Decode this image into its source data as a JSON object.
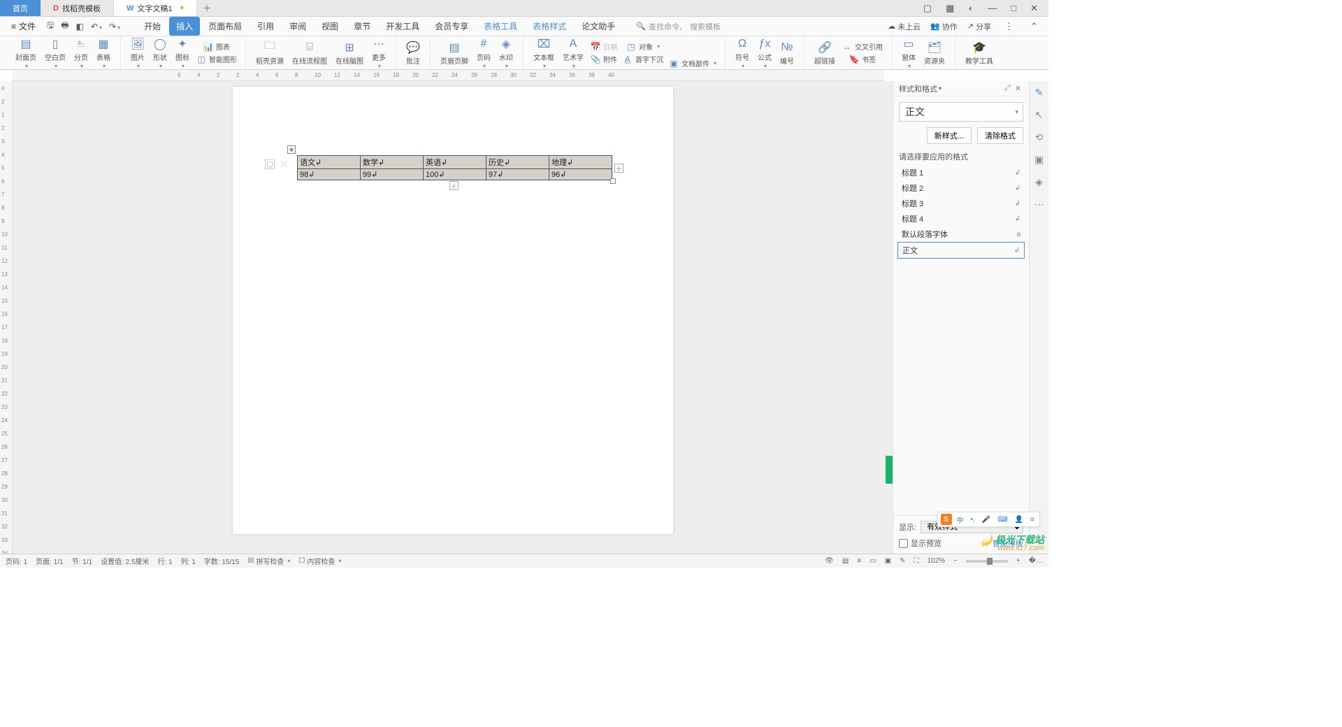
{
  "tabs": {
    "home": "首页",
    "template": "找稻壳模板",
    "doc": "文字文稿1"
  },
  "file_menu": "文件",
  "menu": {
    "start": "开始",
    "insert": "插入",
    "page_layout": "页面布局",
    "references": "引用",
    "review": "审阅",
    "view": "视图",
    "section": "章节",
    "dev": "开发工具",
    "member": "会员专享",
    "table_tools": "表格工具",
    "table_style": "表格样式",
    "paper": "论文助手"
  },
  "search": {
    "find": "查找命令、",
    "template": "搜索模板"
  },
  "topright": {
    "cloud": "未上云",
    "collab": "协作",
    "share": "分享"
  },
  "ribbon": {
    "cover": "封面页",
    "blank": "空白页",
    "pagebreak": "分页",
    "table": "表格",
    "picture": "图片",
    "shape": "形状",
    "icon": "图标",
    "chart": "图表",
    "smartart": "智能图形",
    "docer": "稻壳资源",
    "flowchart": "在线流程图",
    "mindmap": "在线脑图",
    "more": "更多",
    "comment": "批注",
    "headerfooter": "页眉页脚",
    "pagenum": "页码",
    "watermark": "水印",
    "textbox": "文本框",
    "wordart": "艺术字",
    "date": "日期",
    "attach": "附件",
    "object": "对象",
    "dropcap": "首字下沉",
    "docpart": "文档部件",
    "symbol": "符号",
    "equation": "公式",
    "number": "编号",
    "hyperlink": "超链接",
    "crossref": "交叉引用",
    "bookmark": "书签",
    "window": "窗体",
    "resource": "资源夹",
    "edutool": "教学工具"
  },
  "ruler_h": [
    "6",
    "4",
    "2",
    "2",
    "4",
    "6",
    "8",
    "10",
    "12",
    "14",
    "16",
    "18",
    "20",
    "22",
    "24",
    "26",
    "28",
    "30",
    "32",
    "34",
    "36",
    "38",
    "40"
  ],
  "ruler_v": [
    "4",
    "2",
    "1",
    "2",
    "3",
    "4",
    "5",
    "6",
    "7",
    "8",
    "9",
    "10",
    "11",
    "12",
    "13",
    "14",
    "15",
    "16",
    "17",
    "18",
    "19",
    "20",
    "21",
    "22",
    "23",
    "24",
    "25",
    "26",
    "27",
    "28",
    "29",
    "30",
    "31",
    "32",
    "33",
    "34"
  ],
  "table": {
    "headers": [
      "语文",
      "数学",
      "英语",
      "历史",
      "地理"
    ],
    "row1": [
      "98",
      "99",
      "100",
      "97",
      "96"
    ]
  },
  "pane": {
    "title": "样式和格式",
    "current": "正文",
    "new_style": "新样式...",
    "clear": "清除格式",
    "choose_label": "请选择要应用的格式",
    "styles": [
      "标题 1",
      "标题 2",
      "标题 3",
      "标题 4",
      "默认段落字体",
      "正文"
    ],
    "show_label": "显示:",
    "show_value": "有效样式",
    "preview": "显示预览",
    "smart": "智能排版"
  },
  "status": {
    "page_no": "页码: 1",
    "page": "页面: 1/1",
    "section": "节: 1/1",
    "pos": "设置值: 2.5厘米",
    "line": "行: 1",
    "col": "列: 1",
    "words": "字数: 15/15",
    "spell": "拼写检查",
    "content": "内容检查",
    "zoom": "102%"
  },
  "watermark": {
    "line1": "极光下载站",
    "line2": "www.xz7.com"
  }
}
